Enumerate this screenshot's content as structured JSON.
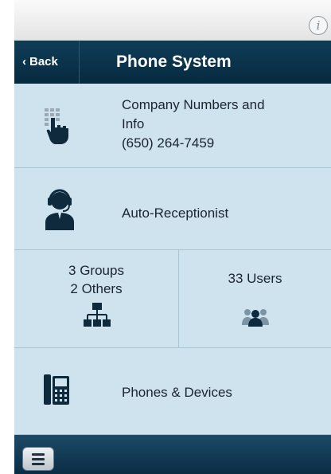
{
  "colors": {
    "navbar": "#062a40",
    "row_bg": "#cfe3ef",
    "divider": "#a9c4d4",
    "icon": "#0f2a3c"
  },
  "header": {
    "info_icon": "i",
    "back_label": "Back",
    "title": "Phone System"
  },
  "rows": {
    "company": {
      "line1": "Company Numbers and",
      "line2": "Info",
      "line3": "(650) 264-7459",
      "icon": "keypad-hand-icon"
    },
    "auto_receptionist": {
      "label": "Auto-Receptionist",
      "icon": "headset-person-icon"
    },
    "groups": {
      "line1": "3 Groups",
      "line2": "2 Others",
      "icon": "org-chart-icon"
    },
    "users": {
      "label": "33 Users",
      "icon": "users-group-icon"
    },
    "phones": {
      "label": "Phones & Devices",
      "icon": "desk-phone-icon"
    }
  },
  "toolbar": {
    "menu_icon": "hamburger-menu-icon"
  }
}
